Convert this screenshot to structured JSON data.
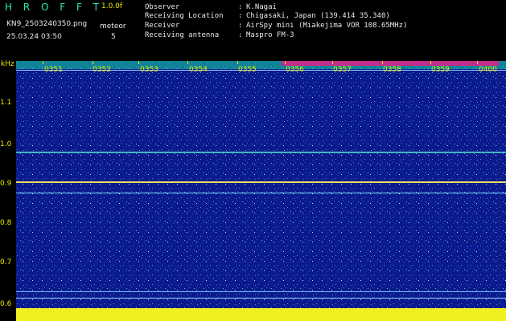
{
  "header": {
    "app_title": "H R O F F T",
    "version": "1.0.0f",
    "filename": "KN9_2503240350.png",
    "datetime": "25.03.24 03:50",
    "meteor_label": "meteor",
    "meteor_count": "5"
  },
  "info": [
    {
      "key": "Observer",
      "value": "K.Nagai"
    },
    {
      "key": "Receiving Location",
      "value": "Chigasaki, Japan (139.414 35.340)"
    },
    {
      "key": "Receiver",
      "value": "AirSpy mini (Miakejima VOR 108.65MHz)"
    },
    {
      "key": "Receiving antenna",
      "value": "Maspro FM-3"
    }
  ],
  "axis": {
    "unit": "kHz",
    "ticks": [
      "1.1",
      "1.0",
      "0.9",
      "0.8",
      "0.7",
      "0.6"
    ]
  },
  "time_labels": [
    "0351",
    "0352",
    "0353",
    "0354",
    "0355",
    "0356",
    "0357",
    "0358",
    "0359",
    "0400"
  ],
  "colors": {
    "background": "#0b1a8c",
    "label": "#e8e800",
    "title": "#2fe8a8"
  }
}
